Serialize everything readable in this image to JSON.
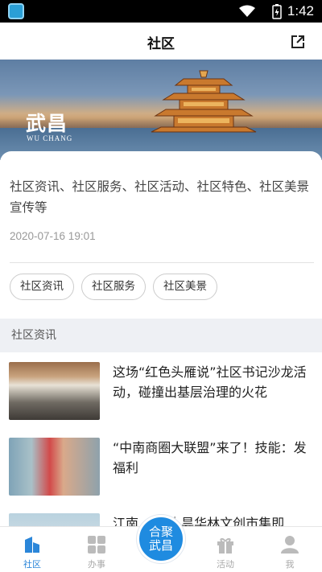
{
  "status_bar": {
    "time": "1:42"
  },
  "header": {
    "title": "社区"
  },
  "banner": {
    "brand_cn": "武昌",
    "brand_en": "WU CHANG"
  },
  "intro": {
    "description": "社区资讯、社区服务、社区活动、社区特色、社区美景宣传等",
    "date": "2020-07-16 19:01",
    "tags": [
      "社区资讯",
      "社区服务",
      "社区美景"
    ]
  },
  "section": {
    "title": "社区资讯"
  },
  "news": [
    {
      "title": "这场“红色头雁说”社区书记沙龙活动，碰撞出基层治理的火花"
    },
    {
      "title": "“中南商圈大联盟”来了！技能：发福利"
    },
    {
      "title": "江南… …｜昙华林文创市集即"
    }
  ],
  "tabbar": {
    "tabs": [
      {
        "label": "社区",
        "icon": "community-icon"
      },
      {
        "label": "办事",
        "icon": "grid-icon"
      },
      {
        "label": "活动",
        "icon": "gift-icon"
      },
      {
        "label": "我",
        "icon": "user-icon"
      }
    ],
    "center_label": "合聚武昌"
  },
  "colors": {
    "accent": "#2b86d9",
    "center_button": "#1f8be0"
  }
}
